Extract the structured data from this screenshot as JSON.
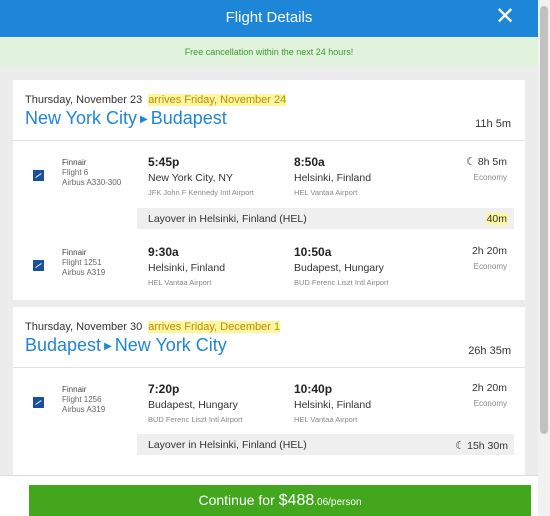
{
  "header": {
    "title": "Flight Details",
    "close_icon": "close-icon"
  },
  "notice": "Free cancellation within the next 24 hours!",
  "trips": [
    {
      "date": "Thursday, November 23",
      "arrives": "arrives Friday, November 24",
      "origin": "New York City",
      "destination": "Budapest",
      "duration": "11h 5m",
      "segments": [
        {
          "airline": "Finnair",
          "flight": "Flight 6",
          "aircraft": "Airbus A330-300",
          "dep_time": "5:45p",
          "dep_city": "New York City, NY",
          "dep_airport": "JFK John F Kennedy Intl Airport",
          "arr_time": "8:50a",
          "arr_city": "Helsinki, Finland",
          "arr_airport": "HEL Vantaa Airport",
          "duration": "8h 5m",
          "overnight": true,
          "cabin": "Economy"
        },
        {
          "airline": "Finnair",
          "flight": "Flight 1251",
          "aircraft": "Airbus A319",
          "dep_time": "9:30a",
          "dep_city": "Helsinki, Finland",
          "dep_airport": "HEL Vantaa Airport",
          "arr_time": "10:50a",
          "arr_city": "Budapest, Hungary",
          "arr_airport": "BUD Ferenc Liszt Intl Airport",
          "duration": "2h 20m",
          "cabin": "Economy"
        }
      ],
      "layover": {
        "text": "Layover in Helsinki, Finland (HEL)",
        "time": "40m"
      }
    },
    {
      "date": "Thursday, November 30",
      "arrives": "arrives Friday, December 1",
      "origin": "Budapest",
      "destination": "New York City",
      "duration": "26h 35m",
      "segments": [
        {
          "airline": "Finnair",
          "flight": "Flight 1256",
          "aircraft": "Airbus A319",
          "dep_time": "7:20p",
          "dep_city": "Budapest, Hungary",
          "dep_airport": "BUD Ferenc Liszt Intl Airport",
          "arr_time": "10:40p",
          "arr_city": "Helsinki, Finland",
          "arr_airport": "HEL Vantaa Airport",
          "duration": "2h 20m",
          "cabin": "Economy"
        }
      ],
      "layover": {
        "text": "Layover in Helsinki, Finland (HEL)",
        "time": "15h 30m"
      }
    }
  ],
  "continue": {
    "label": "Continue for ",
    "price": "$488",
    "cents": ".06/person"
  },
  "colors": {
    "accent": "#1e86d8",
    "cta": "#42a71d",
    "notice_bg": "#e1f3dc",
    "highlight": "#fdf5a0"
  }
}
